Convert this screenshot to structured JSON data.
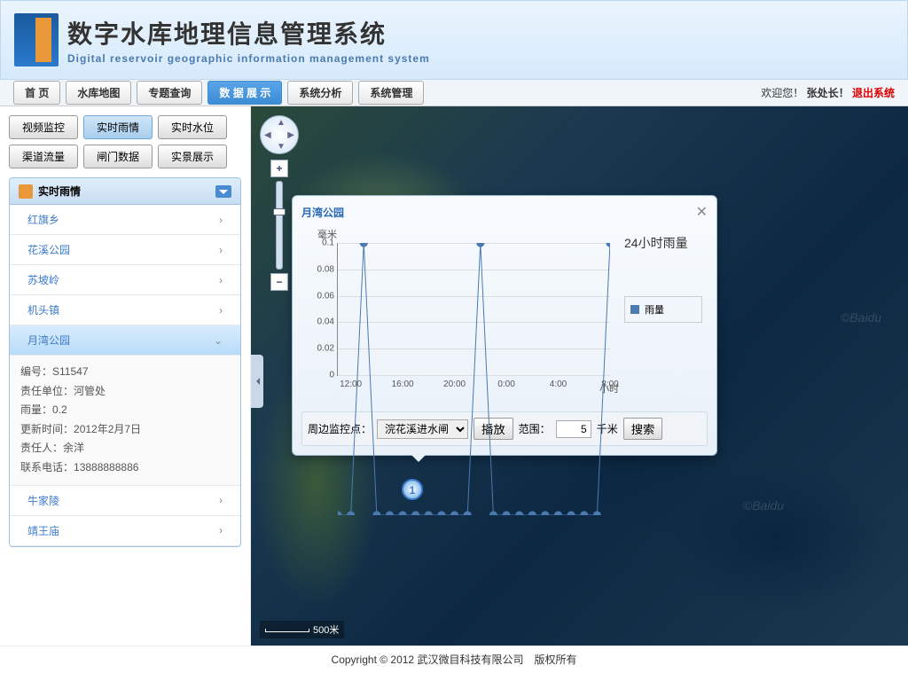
{
  "header": {
    "title_zh": "数字水库地理信息管理系统",
    "title_en": "Digital reservoir geographic information management system"
  },
  "nav": {
    "tabs": [
      "首 页",
      "水库地图",
      "专题查询",
      "数 据 展 示",
      "系统分析",
      "系统管理"
    ],
    "active_index": 3,
    "welcome": "欢迎您！",
    "user": "张处长！",
    "logout": "退出系统"
  },
  "sidebar": {
    "sub_buttons": [
      "视频监控",
      "实时雨情",
      "实时水位",
      "渠道流量",
      "闸门数据",
      "实景展示"
    ],
    "active_sub": 1,
    "panel_title": "实时雨情",
    "stations": [
      "红旗乡",
      "花溪公园",
      "苏坡岭",
      "机头镇",
      "月湾公园",
      "牛家陵",
      "靖王庙"
    ],
    "selected_index": 4,
    "detail": {
      "id_label": "编号：",
      "id_value": "S11547",
      "unit_label": "责任单位：",
      "unit_value": "河管处",
      "rain_label": "雨量：",
      "rain_value": "0.2",
      "time_label": "更新时间：",
      "time_value": "2012年2月7日",
      "person_label": "责任人：",
      "person_value": "余洋",
      "phone_label": "联系电话：",
      "phone_value": "13888888886"
    }
  },
  "map": {
    "scale": "500米",
    "marker_number": "1",
    "watermark": "©Baidu"
  },
  "popup": {
    "title": "月湾公园",
    "side_title": "24小时雨量",
    "legend": "雨量",
    "ylabel": "毫米",
    "xlabel": "小时",
    "controls": {
      "monitor_label": "周边监控点：",
      "monitor_selected": "浣花溪进水闸",
      "play": "播放",
      "range_label": "范围：",
      "range_value": "5",
      "range_unit": "千米",
      "search": "搜索"
    }
  },
  "chart_data": {
    "type": "line",
    "title": "24小时雨量",
    "ylabel": "毫米",
    "xlabel": "小时",
    "ylim": [
      0,
      0.1
    ],
    "series": [
      {
        "name": "雨量",
        "values": [
          0,
          0,
          0.1,
          0,
          0,
          0,
          0,
          0,
          0,
          0,
          0,
          0.1,
          0,
          0,
          0,
          0,
          0,
          0,
          0,
          0,
          0,
          0.1
        ]
      }
    ],
    "x_ticks": [
      "12:00",
      "16:00",
      "20:00",
      "0:00",
      "4:00",
      "8:00"
    ]
  },
  "footer": "Copyright © 2012 武汉微目科技有限公司　版权所有"
}
